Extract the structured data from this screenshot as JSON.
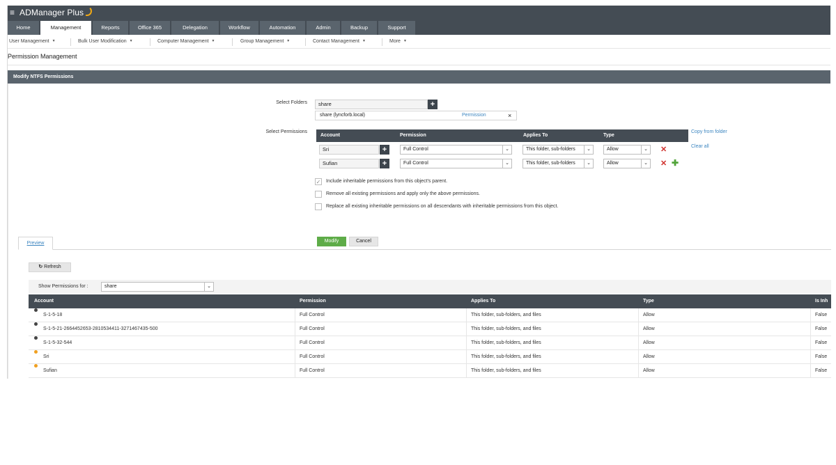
{
  "app": {
    "brand": "ADManager Plus",
    "menu_glyph": "≡"
  },
  "tabs": [
    "Home",
    "Management",
    "Reports",
    "Office 365",
    "Delegation",
    "Workflow",
    "Automation",
    "Admin",
    "Backup",
    "Support"
  ],
  "active_tab": "Management",
  "subnav": [
    "User Management",
    "Bulk User Modification",
    "Computer Management",
    "Group Management",
    "Contact Management",
    "More"
  ],
  "page_title": "Permission Management",
  "section_title": "Modify NTFS Permissions",
  "folders": {
    "label": "Select Folders",
    "input_value": "share",
    "selected": "share (lyncforb.local)",
    "permission_link": "Permission",
    "remove_glyph": "×"
  },
  "permissions": {
    "label": "Select Permissions",
    "headers": [
      "Account",
      "Permission",
      "Applies To",
      "Type"
    ],
    "rows": [
      {
        "account": "Sri",
        "permission": "Full Control",
        "applies_to": "This folder, sub-folders",
        "type": "Allow"
      },
      {
        "account": "Sufian",
        "permission": "Full Control",
        "applies_to": "This folder, sub-folders",
        "type": "Allow"
      }
    ],
    "copy_link": "Copy from folder",
    "clear_link": "Clear all"
  },
  "options": [
    {
      "label": "Include inheritable permissions from this object's parent.",
      "checked": true
    },
    {
      "label": "Remove all existing permissions and apply only the above permissions.",
      "checked": false
    },
    {
      "label": "Replace all existing inheritable permissions on all descendants with inheritable permissions from this object.",
      "checked": false
    }
  ],
  "buttons": {
    "modify": "Modify",
    "cancel": "Cancel"
  },
  "preview": {
    "tab_label": "Preview",
    "refresh_label": "Refresh",
    "filter_label": "Show Permissions for :",
    "filter_value": "share",
    "headers": [
      "Account",
      "Permission",
      "Applies To",
      "Type",
      "Is Inh"
    ],
    "rows": [
      {
        "account": "S-1-5-18",
        "permission": "Full Control",
        "applies_to": "This folder, sub-folders, and files",
        "type": "Allow",
        "inherited": "False",
        "marker": "dark"
      },
      {
        "account": "S-1-5-21-2664452653-2810534411-3271467435-500",
        "permission": "Full Control",
        "applies_to": "This folder, sub-folders, and files",
        "type": "Allow",
        "inherited": "False",
        "marker": "dark"
      },
      {
        "account": "S-1-5-32-544",
        "permission": "Full Control",
        "applies_to": "This folder, sub-folders, and files",
        "type": "Allow",
        "inherited": "False",
        "marker": "dark"
      },
      {
        "account": "Sri",
        "permission": "Full Control",
        "applies_to": "This folder, sub-folders, and files",
        "type": "Allow",
        "inherited": "False",
        "marker": "orange"
      },
      {
        "account": "Sufian",
        "permission": "Full Control",
        "applies_to": "This folder, sub-folders, and files",
        "type": "Allow",
        "inherited": "False",
        "marker": "orange"
      }
    ]
  },
  "colors": {
    "dark": "#444444",
    "orange": "#f0a020",
    "header": "#444c54",
    "accent": "#5eac48"
  }
}
